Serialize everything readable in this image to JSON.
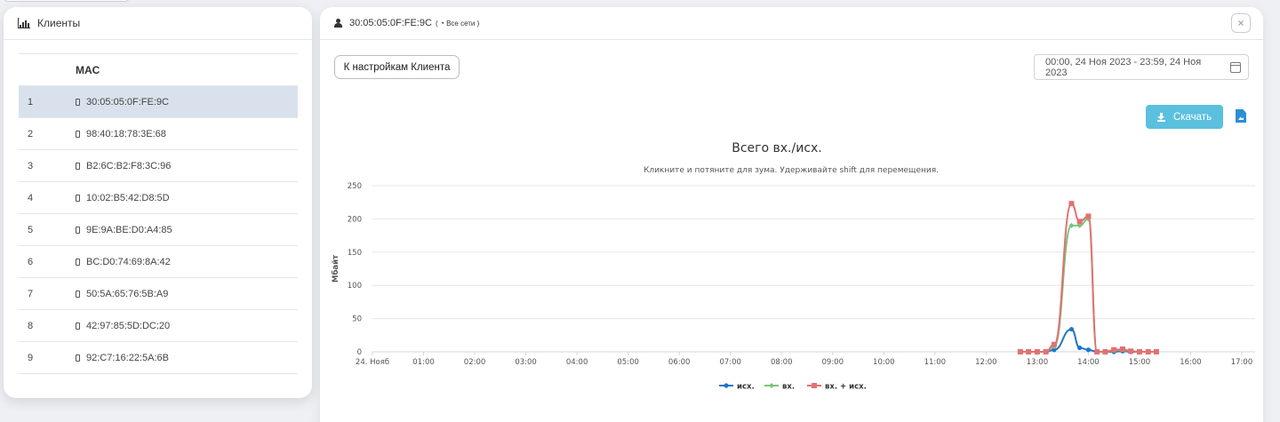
{
  "clients_panel": {
    "title": "Клиенты",
    "column_header": "MAC",
    "rows": [
      {
        "num": "1",
        "mac": "30:05:05:0F:FE:9C"
      },
      {
        "num": "2",
        "mac": "98:40:18:78:3E:68"
      },
      {
        "num": "3",
        "mac": "B2:6C:B2:F8:3C:96"
      },
      {
        "num": "4",
        "mac": "10:02:B5:42:D8:5D"
      },
      {
        "num": "5",
        "mac": "9E:9A:BE:D0:A4:85"
      },
      {
        "num": "6",
        "mac": "BC:D0:74:69:8A:42"
      },
      {
        "num": "7",
        "mac": "50:5A:65:76:5B:A9"
      },
      {
        "num": "8",
        "mac": "42:97:85:5D:DC:20"
      },
      {
        "num": "9",
        "mac": "92:C7:16:22:5A:6B"
      }
    ],
    "selected_index": 0
  },
  "detail_panel": {
    "mac": "30:05:05:0F:FE:9C",
    "network_open": "(",
    "network": "Все сети",
    "network_close": ")",
    "close_label": "×",
    "settings_button": "К настройкам Клиента",
    "date_range": "00:00, 24 Ноя 2023 - 23:59, 24 Ноя 2023",
    "download_button": "Скачать"
  },
  "colors": {
    "series_out": "#1f77c4",
    "series_in": "#7cc47c",
    "series_total": "#e07272",
    "accent": "#5bc0de",
    "selected_row": "#d9e2ec"
  },
  "chart_data": {
    "type": "line",
    "title": "Всего вх./исх.",
    "subtitle": "Кликните и потяните для зума. Удерживайте shift для перемещения.",
    "xlabel": "",
    "ylabel": "Мбайт",
    "x_tick_labels": [
      "24. Нояб",
      "01:00",
      "02:00",
      "03:00",
      "04:00",
      "05:00",
      "06:00",
      "07:00",
      "08:00",
      "09:00",
      "10:00",
      "11:00",
      "12:00",
      "13:00",
      "14:00",
      "15:00",
      "16:00",
      "17:00"
    ],
    "xlim": [
      0,
      17
    ],
    "ylim": [
      0,
      250
    ],
    "y_ticks": [
      0,
      50,
      100,
      150,
      200,
      250
    ],
    "grid": true,
    "legend_position": "bottom",
    "series": [
      {
        "name": "исх.",
        "color": "#1f77c4",
        "marker": "circle",
        "points": [
          [
            12.67,
            0
          ],
          [
            12.83,
            0
          ],
          [
            13.0,
            0
          ],
          [
            13.17,
            0
          ],
          [
            13.33,
            3
          ],
          [
            13.67,
            34
          ],
          [
            13.83,
            6
          ],
          [
            14.0,
            3
          ],
          [
            14.17,
            0
          ],
          [
            14.33,
            0
          ],
          [
            14.5,
            0
          ],
          [
            14.67,
            1
          ],
          [
            14.83,
            0
          ],
          [
            15.0,
            0
          ],
          [
            15.17,
            0
          ],
          [
            15.33,
            0
          ]
        ]
      },
      {
        "name": "вх.",
        "color": "#7cc47c",
        "marker": "diamond",
        "points": [
          [
            12.67,
            0
          ],
          [
            12.83,
            0
          ],
          [
            13.0,
            0
          ],
          [
            13.17,
            0
          ],
          [
            13.33,
            8
          ],
          [
            13.67,
            190
          ],
          [
            13.83,
            190
          ],
          [
            14.0,
            200
          ],
          [
            14.17,
            0
          ],
          [
            14.33,
            0
          ],
          [
            14.5,
            2
          ],
          [
            14.67,
            3
          ],
          [
            14.83,
            1
          ],
          [
            15.0,
            0
          ],
          [
            15.17,
            0
          ],
          [
            15.33,
            0
          ]
        ]
      },
      {
        "name": "вх. + исх.",
        "color": "#e07272",
        "marker": "square",
        "points": [
          [
            12.67,
            0
          ],
          [
            12.83,
            0
          ],
          [
            13.0,
            0
          ],
          [
            13.17,
            0
          ],
          [
            13.33,
            11
          ],
          [
            13.67,
            223
          ],
          [
            13.83,
            196
          ],
          [
            14.0,
            204
          ],
          [
            14.17,
            0
          ],
          [
            14.33,
            0
          ],
          [
            14.5,
            3
          ],
          [
            14.67,
            4
          ],
          [
            14.83,
            1
          ],
          [
            15.0,
            0
          ],
          [
            15.17,
            0
          ],
          [
            15.33,
            0
          ]
        ]
      }
    ]
  }
}
